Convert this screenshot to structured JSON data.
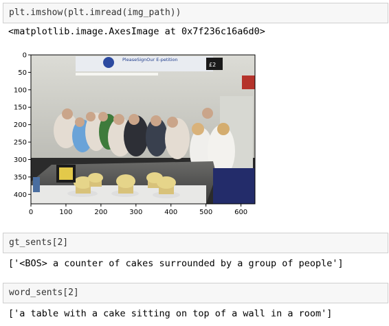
{
  "cells": {
    "c1_input": "plt.imshow(plt.imread(img_path))",
    "c1_output": "<matplotlib.image.AxesImage at 0x7f236c16a6d0>",
    "c2_input": "gt_sents[2]",
    "c2_output": "['<BOS> a counter of cakes surrounded by a group of people']",
    "c3_input": "word_sents[2]",
    "c3_output": "['a table with a cake sitting on top of a wall in a room']"
  },
  "image": {
    "banner_text": "PleaseSignOur E-petition",
    "price_text": "£2"
  },
  "chart_data": {
    "type": "image",
    "xticks": [
      0,
      100,
      200,
      300,
      400,
      500,
      600
    ],
    "yticks": [
      0,
      50,
      100,
      150,
      200,
      250,
      300,
      350,
      400
    ],
    "xlim": [
      0,
      640
    ],
    "ylim": [
      427,
      0
    ],
    "grid": false
  }
}
